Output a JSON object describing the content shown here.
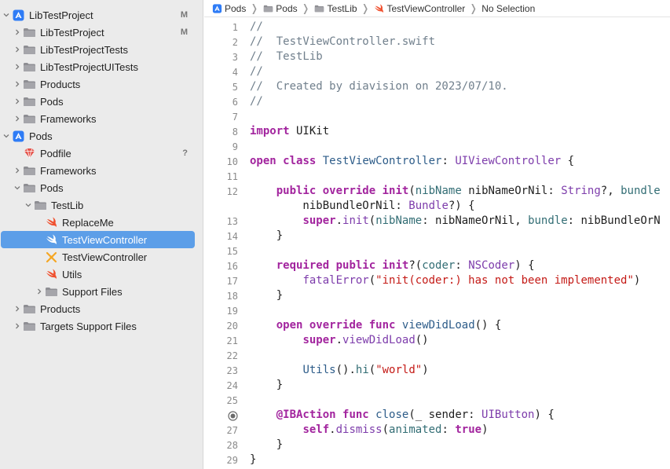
{
  "navigator": {
    "items": [
      {
        "label": "LibTestProject",
        "badge": "M",
        "icon": "xcodeproj-icon",
        "disclosure": "expanded",
        "indent": 0
      },
      {
        "label": "LibTestProject",
        "badge": "M",
        "icon": "folder-icon",
        "disclosure": "collapsed",
        "indent": 1
      },
      {
        "label": "LibTestProjectTests",
        "badge": "",
        "icon": "folder-icon",
        "disclosure": "collapsed",
        "indent": 1
      },
      {
        "label": "LibTestProjectUITests",
        "badge": "",
        "icon": "folder-icon",
        "disclosure": "collapsed",
        "indent": 1
      },
      {
        "label": "Products",
        "badge": "",
        "icon": "folder-icon",
        "disclosure": "collapsed",
        "indent": 1
      },
      {
        "label": "Pods",
        "badge": "",
        "icon": "folder-icon",
        "disclosure": "collapsed",
        "indent": 1
      },
      {
        "label": "Frameworks",
        "badge": "",
        "icon": "folder-icon",
        "disclosure": "collapsed",
        "indent": 1
      },
      {
        "label": "Pods",
        "badge": "",
        "icon": "xcodeproj-icon",
        "disclosure": "expanded",
        "indent": 0
      },
      {
        "label": "Podfile",
        "badge": "?",
        "icon": "ruby-gem-icon",
        "disclosure": "none",
        "indent": 1
      },
      {
        "label": "Frameworks",
        "badge": "",
        "icon": "folder-icon",
        "disclosure": "collapsed",
        "indent": 1
      },
      {
        "label": "Pods",
        "badge": "",
        "icon": "folder-icon",
        "disclosure": "expanded",
        "indent": 1
      },
      {
        "label": "TestLib",
        "badge": "",
        "icon": "folder-icon",
        "disclosure": "expanded",
        "indent": 2
      },
      {
        "label": "ReplaceMe",
        "badge": "",
        "icon": "swift-file-icon",
        "disclosure": "none",
        "indent": 3
      },
      {
        "label": "TestViewController",
        "badge": "",
        "icon": "swift-file-icon",
        "disclosure": "none",
        "indent": 3,
        "selected": true
      },
      {
        "label": "TestViewController",
        "badge": "",
        "icon": "xib-file-icon",
        "disclosure": "none",
        "indent": 3
      },
      {
        "label": "Utils",
        "badge": "",
        "icon": "swift-file-icon",
        "disclosure": "none",
        "indent": 3
      },
      {
        "label": "Support Files",
        "badge": "",
        "icon": "folder-icon",
        "disclosure": "collapsed",
        "indent": 3
      },
      {
        "label": "Products",
        "badge": "",
        "icon": "folder-icon",
        "disclosure": "collapsed",
        "indent": 1
      },
      {
        "label": "Targets Support Files",
        "badge": "",
        "icon": "folder-icon",
        "disclosure": "collapsed",
        "indent": 1
      }
    ]
  },
  "jumpbar": {
    "crumbs": [
      {
        "label": "Pods",
        "icon": "xcodeproj-icon"
      },
      {
        "label": "Pods",
        "icon": "folder-icon"
      },
      {
        "label": "TestLib",
        "icon": "folder-icon"
      },
      {
        "label": "TestViewController",
        "icon": "swift-file-icon"
      },
      {
        "label": "No Selection",
        "icon": ""
      }
    ]
  },
  "editor": {
    "lines": [
      {
        "num": "1",
        "tokens": [
          [
            "cmt",
            "//"
          ]
        ]
      },
      {
        "num": "2",
        "tokens": [
          [
            "cmt",
            "//  TestViewController.swift"
          ]
        ]
      },
      {
        "num": "3",
        "tokens": [
          [
            "cmt",
            "//  TestLib"
          ]
        ]
      },
      {
        "num": "4",
        "tokens": [
          [
            "cmt",
            "//"
          ]
        ]
      },
      {
        "num": "5",
        "tokens": [
          [
            "cmt",
            "//  Created by diavision on 2023/07/10."
          ]
        ]
      },
      {
        "num": "6",
        "tokens": [
          [
            "cmt",
            "//"
          ]
        ]
      },
      {
        "num": "7",
        "tokens": []
      },
      {
        "num": "8",
        "tokens": [
          [
            "kw",
            "import"
          ],
          [
            "",
            " UIKit"
          ]
        ]
      },
      {
        "num": "9",
        "tokens": []
      },
      {
        "num": "10",
        "tokens": [
          [
            "kw",
            "open"
          ],
          [
            "",
            " "
          ],
          [
            "kw",
            "class"
          ],
          [
            "",
            " "
          ],
          [
            "type",
            "TestViewController"
          ],
          [
            "",
            ": "
          ],
          [
            "sys",
            "UIViewController"
          ],
          [
            "",
            " {"
          ]
        ]
      },
      {
        "num": "11",
        "tokens": []
      },
      {
        "num": "12",
        "tokens": [
          [
            "",
            "    "
          ],
          [
            "kw",
            "public"
          ],
          [
            "",
            " "
          ],
          [
            "kw",
            "override"
          ],
          [
            "",
            " "
          ],
          [
            "kw",
            "init"
          ],
          [
            "",
            "("
          ],
          [
            "fn",
            "nibName"
          ],
          [
            "",
            " nibNameOrNil: "
          ],
          [
            "sys",
            "String"
          ],
          [
            "",
            "?, "
          ],
          [
            "fn",
            "bundle"
          ]
        ]
      },
      {
        "num": "",
        "tokens": [
          [
            "",
            "        nibBundleOrNil: "
          ],
          [
            "sys",
            "Bundle"
          ],
          [
            "",
            "?) {"
          ]
        ]
      },
      {
        "num": "13",
        "tokens": [
          [
            "",
            "        "
          ],
          [
            "kw",
            "super"
          ],
          [
            "",
            "."
          ],
          [
            "sys",
            "init"
          ],
          [
            "",
            "("
          ],
          [
            "fn",
            "nibName"
          ],
          [
            "",
            ": nibNameOrNil, "
          ],
          [
            "fn",
            "bundle"
          ],
          [
            "",
            ": nibBundleOrN"
          ]
        ]
      },
      {
        "num": "14",
        "tokens": [
          [
            "",
            "    }"
          ]
        ]
      },
      {
        "num": "15",
        "tokens": []
      },
      {
        "num": "16",
        "tokens": [
          [
            "",
            "    "
          ],
          [
            "kw",
            "required"
          ],
          [
            "",
            " "
          ],
          [
            "kw",
            "public"
          ],
          [
            "",
            " "
          ],
          [
            "kw",
            "init"
          ],
          [
            "",
            "?("
          ],
          [
            "fn",
            "coder"
          ],
          [
            "",
            ": "
          ],
          [
            "sys",
            "NSCoder"
          ],
          [
            "",
            ") {"
          ]
        ]
      },
      {
        "num": "17",
        "tokens": [
          [
            "",
            "        "
          ],
          [
            "sys",
            "fatalError"
          ],
          [
            "",
            "("
          ],
          [
            "str",
            "\"init(coder:) has not been implemented\""
          ],
          [
            "",
            ")"
          ]
        ]
      },
      {
        "num": "18",
        "tokens": [
          [
            "",
            "    }"
          ]
        ]
      },
      {
        "num": "19",
        "tokens": []
      },
      {
        "num": "20",
        "tokens": [
          [
            "",
            "    "
          ],
          [
            "kw",
            "open"
          ],
          [
            "",
            " "
          ],
          [
            "kw",
            "override"
          ],
          [
            "",
            " "
          ],
          [
            "kw",
            "func"
          ],
          [
            "",
            " "
          ],
          [
            "type",
            "viewDidLoad"
          ],
          [
            "",
            "() {"
          ]
        ]
      },
      {
        "num": "21",
        "tokens": [
          [
            "",
            "        "
          ],
          [
            "kw",
            "super"
          ],
          [
            "",
            "."
          ],
          [
            "sys",
            "viewDidLoad"
          ],
          [
            "",
            "()"
          ]
        ]
      },
      {
        "num": "22",
        "tokens": []
      },
      {
        "num": "23",
        "tokens": [
          [
            "",
            "        "
          ],
          [
            "type",
            "Utils"
          ],
          [
            "",
            "()."
          ],
          [
            "fn",
            "hi"
          ],
          [
            "",
            "("
          ],
          [
            "str",
            "\"world\""
          ],
          [
            "",
            ")"
          ]
        ]
      },
      {
        "num": "24",
        "tokens": [
          [
            "",
            "    }"
          ]
        ]
      },
      {
        "num": "25",
        "tokens": []
      },
      {
        "num": "",
        "tokens": [
          [
            "",
            "    "
          ],
          [
            "kw",
            "@IBAction"
          ],
          [
            "",
            " "
          ],
          [
            "kw",
            "func"
          ],
          [
            "",
            " "
          ],
          [
            "type",
            "close"
          ],
          [
            "",
            "(_ sender: "
          ],
          [
            "sys",
            "UIButton"
          ],
          [
            "",
            ") {"
          ]
        ],
        "marker": "outlet-connection-icon"
      },
      {
        "num": "27",
        "tokens": [
          [
            "",
            "        "
          ],
          [
            "kw",
            "self"
          ],
          [
            "",
            "."
          ],
          [
            "sys",
            "dismiss"
          ],
          [
            "",
            "("
          ],
          [
            "fn",
            "animated"
          ],
          [
            "",
            ": "
          ],
          [
            "kw",
            "true"
          ],
          [
            "",
            ")"
          ]
        ]
      },
      {
        "num": "28",
        "tokens": [
          [
            "",
            "    }"
          ]
        ]
      },
      {
        "num": "29",
        "tokens": [
          [
            "",
            "}"
          ]
        ]
      }
    ]
  },
  "colors": {
    "selection": "#5c9ee8",
    "keyword": "#a2249e",
    "string": "#c41a16",
    "comment": "#707f8c"
  }
}
